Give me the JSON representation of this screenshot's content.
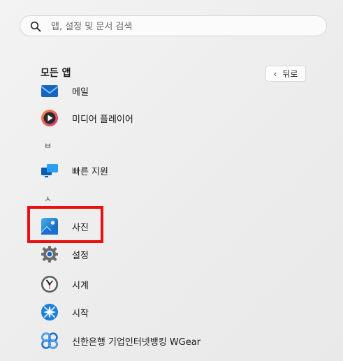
{
  "search": {
    "placeholder": "앱, 설정 및 문서 검색"
  },
  "header": {
    "title": "모든 앱",
    "back_label": "뒤로"
  },
  "apps": [
    {
      "label": "메일",
      "icon": "mail-icon"
    },
    {
      "label": "미디어 플레이어",
      "icon": "media-player-icon"
    },
    {
      "letter": "ㅂ"
    },
    {
      "label": "빠른 지원",
      "icon": "quick-assist-icon"
    },
    {
      "letter": "ㅅ"
    },
    {
      "label": "사진",
      "icon": "photos-icon"
    },
    {
      "label": "설정",
      "icon": "settings-gear-icon"
    },
    {
      "label": "시계",
      "icon": "clock-icon"
    },
    {
      "label": "시작",
      "icon": "get-started-icon"
    },
    {
      "label": "신한은행 기업인터넷뱅킹 WGear",
      "icon": "shinhan-wgear-icon"
    }
  ],
  "colors": {
    "highlight": "#e81010",
    "accent": "#0067c0"
  }
}
